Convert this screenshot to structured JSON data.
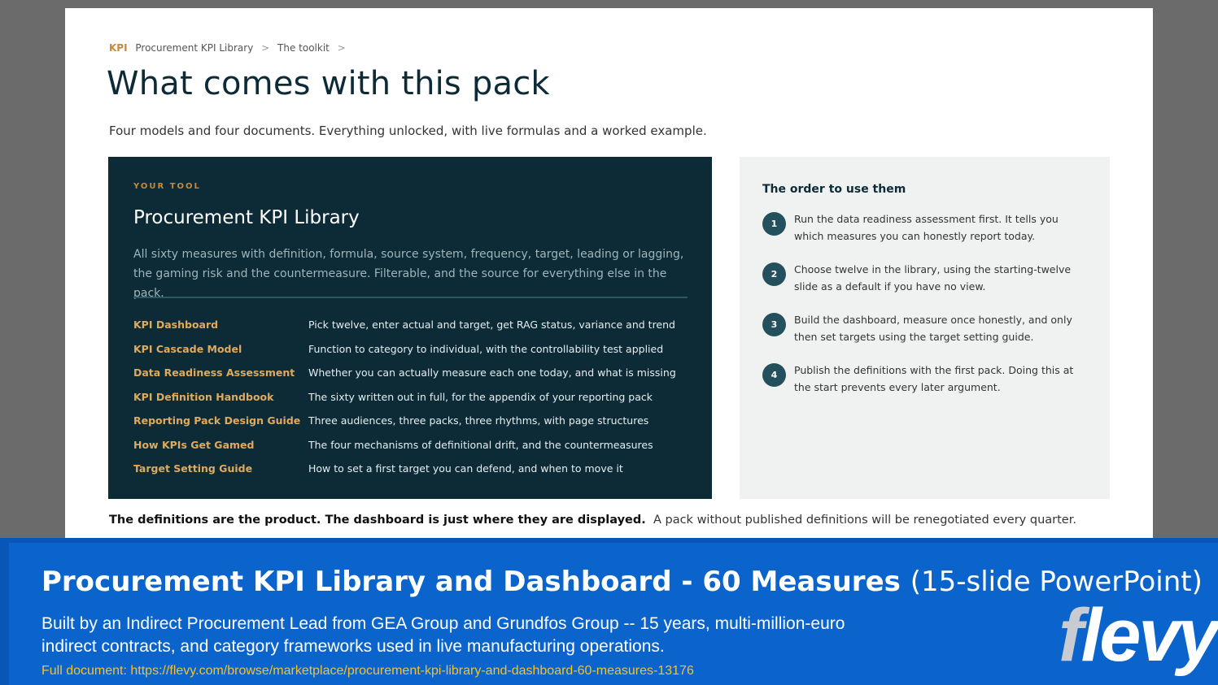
{
  "breadcrumb": {
    "tag": "KPI",
    "items": [
      "Procurement KPI Library",
      "The toolkit"
    ],
    "separator": ">"
  },
  "title": "What comes with this pack",
  "subtitle": "Four models and four documents. Everything unlocked, with live formulas and a worked example.",
  "tool": {
    "eyebrow": "YOUR TOOL",
    "name": "Procurement KPI Library",
    "description": "All sixty measures with definition, formula, source system, frequency, target, leading or lagging, the gaming risk and the countermeasure. Filterable, and the source for everything else in the pack.",
    "rows": [
      {
        "name": "KPI Dashboard",
        "desc": "Pick twelve, enter actual and target, get RAG status, variance and trend"
      },
      {
        "name": "KPI Cascade Model",
        "desc": "Function to category to individual, with the controllability test applied"
      },
      {
        "name": "Data Readiness Assessment",
        "desc": "Whether you can actually measure each one today, and what is missing"
      },
      {
        "name": "KPI Definition Handbook",
        "desc": "The sixty written out in full, for the appendix of your reporting pack"
      },
      {
        "name": "Reporting Pack Design Guide",
        "desc": "Three audiences, three packs, three rhythms, with page structures"
      },
      {
        "name": "How KPIs Get Gamed",
        "desc": "The four mechanisms of definitional drift, and the countermeasures"
      },
      {
        "name": "Target Setting Guide",
        "desc": "How to set a first target you can defend, and when to move it"
      }
    ]
  },
  "order": {
    "title": "The order to use them",
    "steps": [
      {
        "num": "1",
        "text": "Run the data readiness assessment first. It tells you which measures you can honestly report today."
      },
      {
        "num": "2",
        "text": "Choose twelve in the library, using the starting-twelve slide as a default if you have no view."
      },
      {
        "num": "3",
        "text": "Build the dashboard, measure once honestly, and only then set targets using the target setting guide."
      },
      {
        "num": "4",
        "text": "Publish the definitions with the first pack. Doing this at the start prevents every later argument."
      }
    ]
  },
  "footer_note": {
    "bold": "The definitions are the product. The dashboard is just where they are displayed.",
    "normal": "A pack without published definitions will be renegotiated every quarter."
  },
  "banner": {
    "title_bold": "Procurement KPI Library and Dashboard - 60 Measures",
    "title_light": "(15-slide PowerPoint)",
    "description": "Built by an Indirect Procurement Lead from GEA Group and Grundfos Group -- 15 years, multi-million-euro indirect contracts, and category frameworks used in live manufacturing operations.",
    "link": "Full document: https://flevy.com/browse/marketplace/procurement-kpi-library-and-dashboard-60-measures-13176",
    "logo_first": "f",
    "logo_rest": "levy"
  },
  "colors": {
    "navy": "#0c2b36",
    "accent_orange": "#c8883a",
    "banner_blue": "#0a64cc",
    "link_yellow": "#f2c230"
  }
}
